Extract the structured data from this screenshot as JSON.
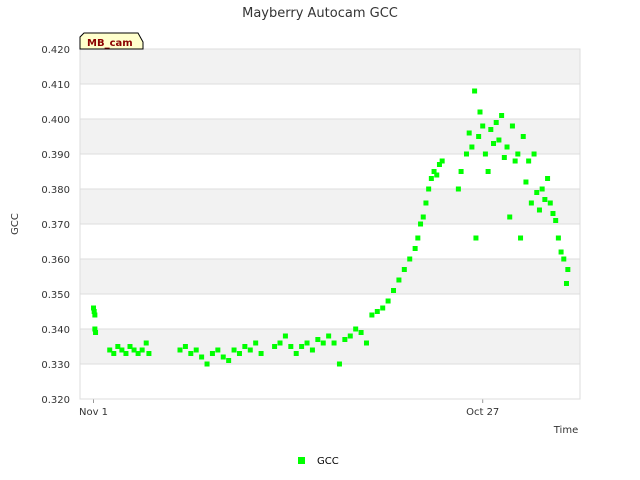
{
  "chart_data": {
    "type": "scatter",
    "title": "Mayberry Autocam GCC",
    "xlabel": "Time",
    "ylabel": "GCC",
    "x_range": [
      "Nov 1",
      "Nov 29"
    ],
    "x_ticks": [
      "Nov 1",
      "Oct 27"
    ],
    "ylim": [
      0.32,
      0.42
    ],
    "y_ticks": [
      "0.320",
      "0.330",
      "0.340",
      "0.350",
      "0.360",
      "0.370",
      "0.380",
      "0.390",
      "0.400",
      "0.410",
      "0.420"
    ],
    "grid": true,
    "legend_position": "bottom",
    "series": [
      {
        "name": "GCC",
        "color": "#00ff00",
        "points": [
          [
            1.0,
            0.346
          ],
          [
            1.05,
            0.345
          ],
          [
            1.1,
            0.344
          ],
          [
            1.1,
            0.34
          ],
          [
            1.15,
            0.339
          ],
          [
            2.2,
            0.334
          ],
          [
            2.5,
            0.333
          ],
          [
            2.8,
            0.335
          ],
          [
            3.1,
            0.334
          ],
          [
            3.4,
            0.333
          ],
          [
            3.7,
            0.335
          ],
          [
            4.0,
            0.334
          ],
          [
            4.3,
            0.333
          ],
          [
            4.6,
            0.334
          ],
          [
            4.9,
            0.336
          ],
          [
            5.1,
            0.333
          ],
          [
            7.4,
            0.334
          ],
          [
            7.8,
            0.335
          ],
          [
            8.2,
            0.333
          ],
          [
            8.6,
            0.334
          ],
          [
            9.0,
            0.332
          ],
          [
            9.4,
            0.33
          ],
          [
            9.8,
            0.333
          ],
          [
            10.2,
            0.334
          ],
          [
            10.6,
            0.332
          ],
          [
            11.0,
            0.331
          ],
          [
            11.4,
            0.334
          ],
          [
            11.8,
            0.333
          ],
          [
            12.2,
            0.335
          ],
          [
            12.6,
            0.334
          ],
          [
            13.0,
            0.336
          ],
          [
            13.4,
            0.333
          ],
          [
            14.4,
            0.335
          ],
          [
            14.8,
            0.336
          ],
          [
            15.2,
            0.338
          ],
          [
            15.6,
            0.335
          ],
          [
            16.0,
            0.333
          ],
          [
            16.4,
            0.335
          ],
          [
            16.8,
            0.336
          ],
          [
            17.2,
            0.334
          ],
          [
            17.6,
            0.337
          ],
          [
            18.0,
            0.336
          ],
          [
            18.4,
            0.338
          ],
          [
            18.8,
            0.336
          ],
          [
            19.2,
            0.33
          ],
          [
            19.6,
            0.337
          ],
          [
            20.0,
            0.338
          ],
          [
            20.4,
            0.34
          ],
          [
            20.8,
            0.339
          ],
          [
            21.2,
            0.336
          ],
          [
            21.6,
            0.344
          ],
          [
            22.0,
            0.345
          ],
          [
            22.4,
            0.346
          ],
          [
            22.8,
            0.348
          ],
          [
            23.2,
            0.351
          ],
          [
            23.6,
            0.354
          ],
          [
            24.0,
            0.357
          ],
          [
            24.4,
            0.36
          ],
          [
            24.8,
            0.363
          ],
          [
            25.0,
            0.366
          ],
          [
            25.2,
            0.37
          ],
          [
            25.4,
            0.372
          ],
          [
            25.6,
            0.376
          ],
          [
            25.8,
            0.38
          ],
          [
            26.0,
            0.383
          ],
          [
            26.2,
            0.385
          ],
          [
            26.4,
            0.384
          ],
          [
            26.6,
            0.387
          ],
          [
            26.8,
            0.388
          ],
          [
            28.0,
            0.38
          ],
          [
            28.2,
            0.385
          ],
          [
            28.6,
            0.39
          ],
          [
            28.8,
            0.396
          ],
          [
            29.0,
            0.392
          ],
          [
            29.2,
            0.408
          ],
          [
            29.3,
            0.366
          ],
          [
            29.5,
            0.395
          ],
          [
            29.6,
            0.402
          ],
          [
            29.8,
            0.398
          ],
          [
            30.0,
            0.39
          ],
          [
            30.2,
            0.385
          ],
          [
            30.4,
            0.397
          ],
          [
            30.6,
            0.393
          ],
          [
            30.8,
            0.399
          ],
          [
            31.0,
            0.394
          ],
          [
            31.2,
            0.401
          ],
          [
            31.4,
            0.389
          ],
          [
            31.6,
            0.392
          ],
          [
            31.8,
            0.372
          ],
          [
            32.0,
            0.398
          ],
          [
            32.2,
            0.388
          ],
          [
            32.4,
            0.39
          ],
          [
            32.6,
            0.366
          ],
          [
            32.8,
            0.395
          ],
          [
            33.0,
            0.382
          ],
          [
            33.2,
            0.388
          ],
          [
            33.4,
            0.376
          ],
          [
            33.6,
            0.39
          ],
          [
            33.8,
            0.379
          ],
          [
            34.0,
            0.374
          ],
          [
            34.2,
            0.38
          ],
          [
            34.4,
            0.377
          ],
          [
            34.6,
            0.383
          ],
          [
            34.8,
            0.376
          ],
          [
            35.0,
            0.373
          ],
          [
            35.2,
            0.371
          ],
          [
            35.4,
            0.366
          ],
          [
            35.6,
            0.362
          ],
          [
            35.8,
            0.36
          ],
          [
            36.0,
            0.353
          ],
          [
            36.1,
            0.357
          ]
        ]
      }
    ]
  },
  "badge": {
    "label": "MB_cam"
  }
}
